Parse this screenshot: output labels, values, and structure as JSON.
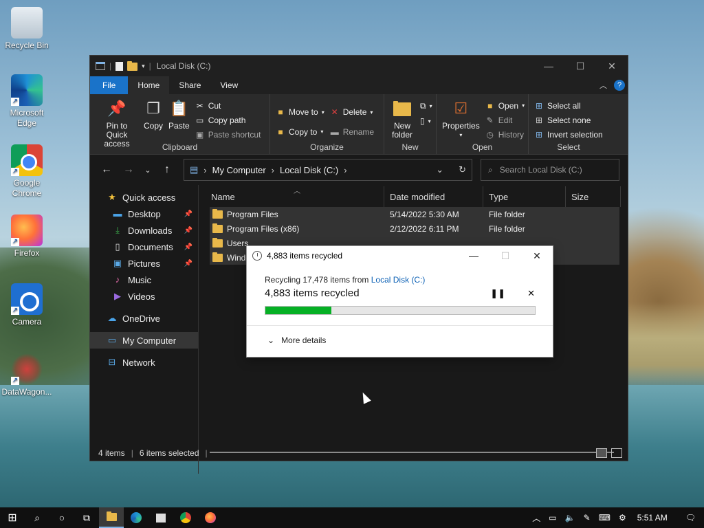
{
  "desktop": {
    "icons": [
      {
        "label": "Recycle Bin",
        "icon": "recycle-bin-icon"
      },
      {
        "label": "Microsoft Edge",
        "icon": "edge-icon"
      },
      {
        "label": "Google Chrome",
        "icon": "chrome-icon"
      },
      {
        "label": "Firefox",
        "icon": "firefox-icon"
      },
      {
        "label": "Camera",
        "icon": "camera-icon"
      },
      {
        "label": "DataWagon...",
        "icon": "datawagon-icon"
      }
    ]
  },
  "explorer": {
    "title": "Local Disk (C:)",
    "tabs": [
      "File",
      "Home",
      "Share",
      "View"
    ],
    "ribbon": {
      "clipboard": {
        "label": "Clipboard",
        "pin": "Pin to Quick access",
        "copy": "Copy",
        "paste": "Paste",
        "cut": "Cut",
        "copy_path": "Copy path",
        "paste_shortcut": "Paste shortcut"
      },
      "organize": {
        "label": "Organize",
        "move_to": "Move to",
        "copy_to": "Copy to",
        "delete": "Delete",
        "rename": "Rename"
      },
      "new": {
        "label": "New",
        "new_folder": "New folder"
      },
      "open": {
        "label": "Open",
        "properties": "Properties",
        "open": "Open",
        "edit": "Edit",
        "history": "History"
      },
      "select": {
        "label": "Select",
        "select_all": "Select all",
        "select_none": "Select none",
        "invert": "Invert selection"
      }
    },
    "address": {
      "root": "My Computer",
      "current": "Local Disk (C:)",
      "search_placeholder": "Search Local Disk (C:)"
    },
    "sidebar": {
      "quick_access": "Quick access",
      "items": [
        "Desktop",
        "Downloads",
        "Documents",
        "Pictures",
        "Music",
        "Videos"
      ],
      "onedrive": "OneDrive",
      "my_computer": "My Computer",
      "network": "Network"
    },
    "columns": [
      "Name",
      "Date modified",
      "Type",
      "Size"
    ],
    "files": [
      {
        "name": "Program Files",
        "date": "5/14/2022 5:30 AM",
        "type": "File folder"
      },
      {
        "name": "Program Files (x86)",
        "date": "2/12/2022 6:11 PM",
        "type": "File folder"
      },
      {
        "name": "Users",
        "date": "",
        "type": ""
      },
      {
        "name": "Windo",
        "date": "",
        "type": ""
      }
    ],
    "status": {
      "items": "4 items",
      "selected": "6 items selected"
    }
  },
  "dialog": {
    "title": "4,883 items recycled",
    "line1_prefix": "Recycling 17,478 items from ",
    "line1_link": "Local Disk (C:)",
    "line2": "4,883 items recycled",
    "progress": 0.244,
    "more_details": "More details"
  },
  "taskbar": {
    "time": "5:51 AM"
  }
}
